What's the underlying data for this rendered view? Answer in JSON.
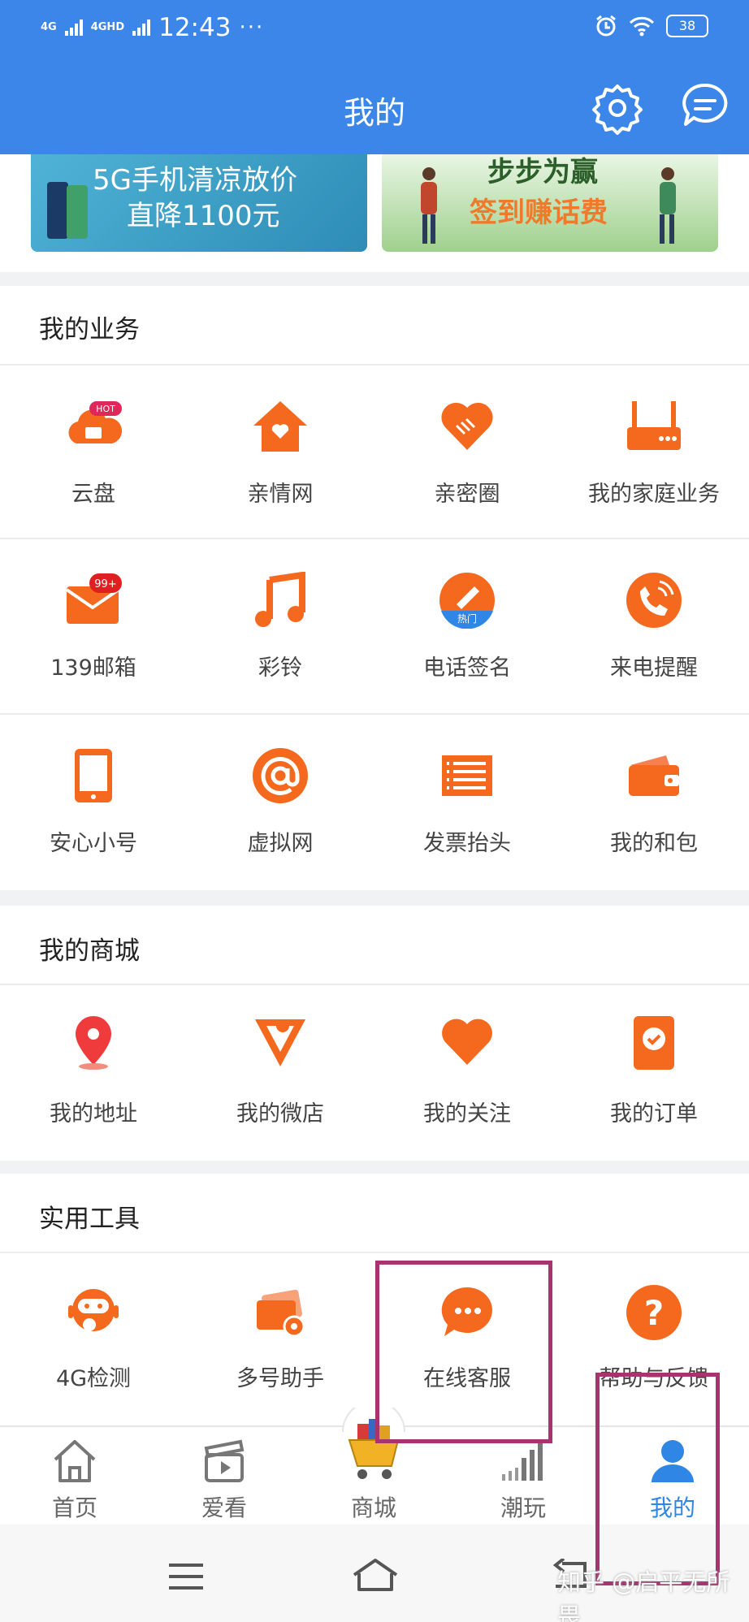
{
  "status_bar": {
    "signal1": "4G",
    "signal2": "4GHD",
    "time": "12:43",
    "dots": "···",
    "battery": "38"
  },
  "header": {
    "title": "我的"
  },
  "banners": [
    {
      "line1": "5G手机清凉放价",
      "line2": "直降1100元"
    },
    {
      "line1": "步步为赢",
      "line2": "签到赚话费"
    }
  ],
  "business": {
    "title": "我的业务",
    "items": [
      {
        "label": "云盘",
        "badge": "HOT",
        "icon": "cloud-drive-icon"
      },
      {
        "label": "亲情网",
        "icon": "home-heart-icon"
      },
      {
        "label": "亲密圈",
        "icon": "handshake-heart-icon"
      },
      {
        "label": "我的家庭业务",
        "icon": "router-icon"
      },
      {
        "label": "139邮箱",
        "badge": "99+",
        "icon": "mail-icon"
      },
      {
        "label": "彩铃",
        "icon": "music-note-icon"
      },
      {
        "label": "电话签名",
        "badge": "热门",
        "icon": "pen-signature-icon"
      },
      {
        "label": "来电提醒",
        "icon": "phone-ring-icon"
      },
      {
        "label": "安心小号",
        "icon": "mobile-phone-icon"
      },
      {
        "label": "虚拟网",
        "icon": "at-sign-icon"
      },
      {
        "label": "发票抬头",
        "icon": "invoice-icon"
      },
      {
        "label": "我的和包",
        "icon": "wallet-icon"
      }
    ]
  },
  "mall": {
    "title": "我的商城",
    "items": [
      {
        "label": "我的地址",
        "icon": "location-pin-icon"
      },
      {
        "label": "我的微店",
        "icon": "store-icon"
      },
      {
        "label": "我的关注",
        "icon": "heart-icon"
      },
      {
        "label": "我的订单",
        "icon": "order-check-icon"
      }
    ]
  },
  "tools": {
    "title": "实用工具",
    "items": [
      {
        "label": "4G检测",
        "icon": "robot-icon"
      },
      {
        "label": "多号助手",
        "icon": "cards-gear-icon"
      },
      {
        "label": "在线客服",
        "icon": "chat-bubble-icon"
      },
      {
        "label": "帮助与反馈",
        "icon": "question-icon"
      }
    ]
  },
  "tabbar": {
    "items": [
      {
        "label": "首页",
        "icon": "home-icon"
      },
      {
        "label": "爱看",
        "icon": "video-clapper-icon"
      },
      {
        "label": "商城",
        "icon": "shopping-cart-icon"
      },
      {
        "label": "潮玩",
        "icon": "signal-bars-icon"
      },
      {
        "label": "我的",
        "icon": "user-icon"
      }
    ]
  },
  "watermark": "知乎 @启平无所畏",
  "colors": {
    "primary_blue": "#3b86e8",
    "orange": "#f4691d",
    "highlight": "#a8336f",
    "active_tab": "#2f86e4"
  }
}
